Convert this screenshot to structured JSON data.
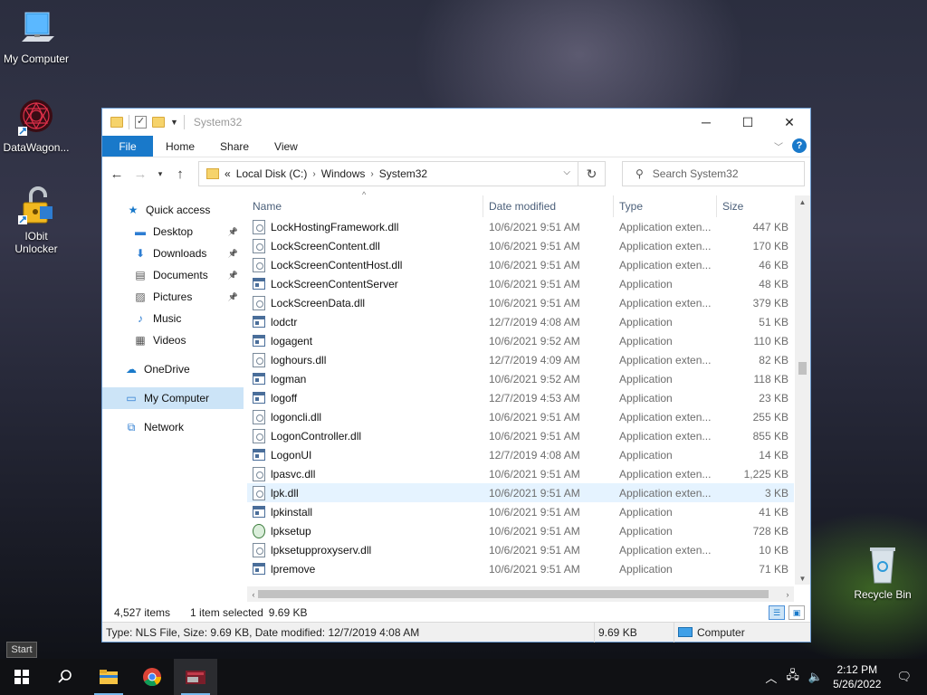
{
  "desktop": {
    "icons": [
      {
        "label": "My Computer"
      },
      {
        "label": "DataWagon..."
      },
      {
        "label": "IObit\nUnlocker"
      },
      {
        "label": "Recycle Bin"
      }
    ]
  },
  "window": {
    "title": "System32",
    "ribbon": {
      "file": "File",
      "tabs": [
        "Home",
        "Share",
        "View"
      ],
      "help": "?"
    },
    "address": {
      "prefix": "«",
      "crumbs": [
        "Local Disk (C:)",
        "Windows",
        "System32"
      ]
    },
    "search": {
      "placeholder": "Search System32"
    },
    "nav": [
      {
        "label": "Quick access",
        "icon": "star-icon",
        "pinned": false
      },
      {
        "label": "Desktop",
        "icon": "desktop-icon",
        "pinned": true
      },
      {
        "label": "Downloads",
        "icon": "download-icon",
        "pinned": true
      },
      {
        "label": "Documents",
        "icon": "documents-icon",
        "pinned": true
      },
      {
        "label": "Pictures",
        "icon": "pictures-icon",
        "pinned": true
      },
      {
        "label": "Music",
        "icon": "music-icon",
        "pinned": false
      },
      {
        "label": "Videos",
        "icon": "videos-icon",
        "pinned": false
      },
      {
        "label": "OneDrive",
        "icon": "cloud-icon",
        "pinned": false
      },
      {
        "label": "My Computer",
        "icon": "computer-icon",
        "pinned": false
      },
      {
        "label": "Network",
        "icon": "network-icon",
        "pinned": false
      }
    ],
    "columns": {
      "name": "Name",
      "date": "Date modified",
      "type": "Type",
      "size": "Size"
    },
    "files": [
      {
        "name": "LockHostingFramework.dll",
        "date": "10/6/2021 9:51 AM",
        "type": "Application exten...",
        "size": "447 KB",
        "icon": "dll"
      },
      {
        "name": "LockScreenContent.dll",
        "date": "10/6/2021 9:51 AM",
        "type": "Application exten...",
        "size": "170 KB",
        "icon": "dll"
      },
      {
        "name": "LockScreenContentHost.dll",
        "date": "10/6/2021 9:51 AM",
        "type": "Application exten...",
        "size": "46 KB",
        "icon": "dll"
      },
      {
        "name": "LockScreenContentServer",
        "date": "10/6/2021 9:51 AM",
        "type": "Application",
        "size": "48 KB",
        "icon": "app"
      },
      {
        "name": "LockScreenData.dll",
        "date": "10/6/2021 9:51 AM",
        "type": "Application exten...",
        "size": "379 KB",
        "icon": "dll"
      },
      {
        "name": "lodctr",
        "date": "12/7/2019 4:08 AM",
        "type": "Application",
        "size": "51 KB",
        "icon": "app"
      },
      {
        "name": "logagent",
        "date": "10/6/2021 9:52 AM",
        "type": "Application",
        "size": "110 KB",
        "icon": "app"
      },
      {
        "name": "loghours.dll",
        "date": "12/7/2019 4:09 AM",
        "type": "Application exten...",
        "size": "82 KB",
        "icon": "dll"
      },
      {
        "name": "logman",
        "date": "10/6/2021 9:52 AM",
        "type": "Application",
        "size": "118 KB",
        "icon": "app"
      },
      {
        "name": "logoff",
        "date": "12/7/2019 4:53 AM",
        "type": "Application",
        "size": "23 KB",
        "icon": "app"
      },
      {
        "name": "logoncli.dll",
        "date": "10/6/2021 9:51 AM",
        "type": "Application exten...",
        "size": "255 KB",
        "icon": "dll"
      },
      {
        "name": "LogonController.dll",
        "date": "10/6/2021 9:51 AM",
        "type": "Application exten...",
        "size": "855 KB",
        "icon": "dll"
      },
      {
        "name": "LogonUI",
        "date": "12/7/2019 4:08 AM",
        "type": "Application",
        "size": "14 KB",
        "icon": "app"
      },
      {
        "name": "lpasvc.dll",
        "date": "10/6/2021 9:51 AM",
        "type": "Application exten...",
        "size": "1,225 KB",
        "icon": "dll"
      },
      {
        "name": "lpk.dll",
        "date": "10/6/2021 9:51 AM",
        "type": "Application exten...",
        "size": "3 KB",
        "icon": "dll"
      },
      {
        "name": "lpkinstall",
        "date": "10/6/2021 9:51 AM",
        "type": "Application",
        "size": "41 KB",
        "icon": "app"
      },
      {
        "name": "lpksetup",
        "date": "10/6/2021 9:51 AM",
        "type": "Application",
        "size": "728 KB",
        "icon": "setup"
      },
      {
        "name": "lpksetupproxyserv.dll",
        "date": "10/6/2021 9:51 AM",
        "type": "Application exten...",
        "size": "10 KB",
        "icon": "dll"
      },
      {
        "name": "lpremove",
        "date": "10/6/2021 9:51 AM",
        "type": "Application",
        "size": "71 KB",
        "icon": "app"
      }
    ],
    "selected_index": 14,
    "status": {
      "count": "4,527 items",
      "selection": "1 item selected",
      "sel_size": "9.69 KB"
    },
    "infobar": {
      "details": "Type: NLS File, Size: 9.69 KB, Date modified: 12/7/2019 4:08 AM",
      "size": "9.69 KB",
      "location": "Computer"
    }
  },
  "start_tooltip": "Start",
  "taskbar": {
    "time": "2:12 PM",
    "date": "5/26/2022"
  },
  "colors": {
    "accent": "#1979ca",
    "selection": "#cce4f7",
    "row_hover": "#e5f3ff"
  }
}
